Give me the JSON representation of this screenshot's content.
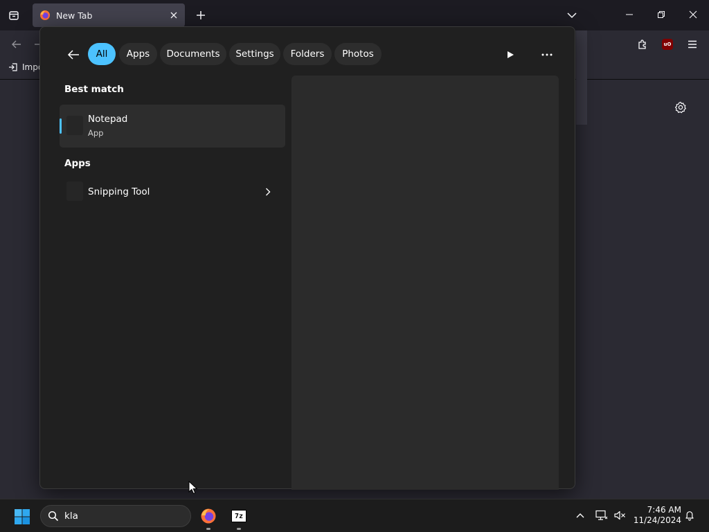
{
  "browser": {
    "tab_title": "New Tab",
    "bookmark_import": "Impo"
  },
  "search_flyout": {
    "filters": [
      "All",
      "Apps",
      "Documents",
      "Settings",
      "Folders",
      "Photos"
    ],
    "active_filter": "All",
    "best_match_label": "Best match",
    "best_match": {
      "name": "Notepad",
      "type": "App"
    },
    "apps_label": "Apps",
    "apps": [
      {
        "name": "Snipping Tool"
      }
    ]
  },
  "taskbar": {
    "search_value": "kla",
    "time": "7:46 AM",
    "date": "11/24/2024"
  },
  "colors": {
    "accent": "#4cc2ff",
    "flyout_bg": "#202020",
    "taskbar_bg": "#1c1c1c"
  }
}
